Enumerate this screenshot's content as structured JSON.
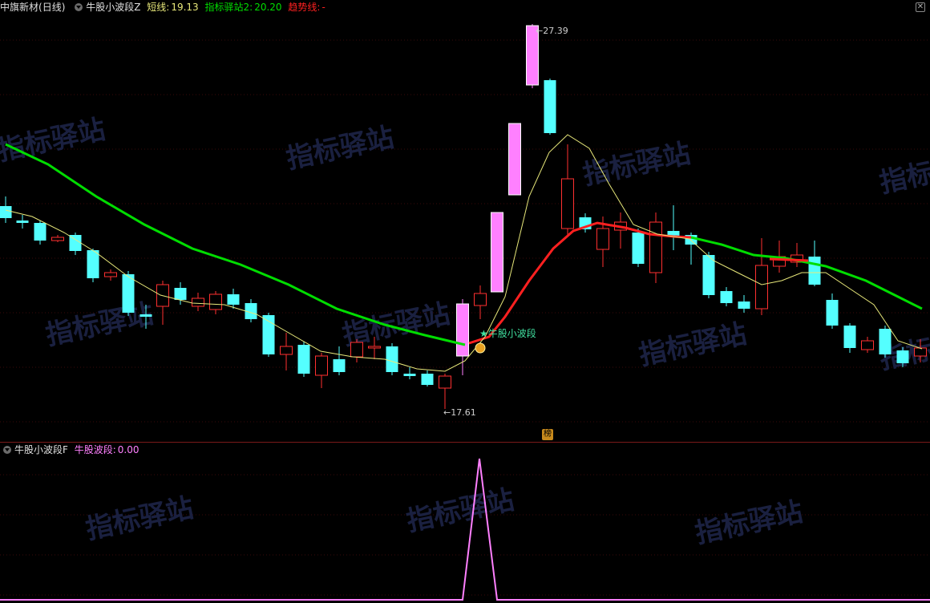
{
  "main": {
    "stock_name": "中旗新材",
    "period": "(日线)",
    "indicator_name": "牛股小波段Z",
    "short_line_label": "短线:",
    "short_line_value": "19.13",
    "zhibiao2_label": "指标驿站2:",
    "zhibiao2_value": "20.20",
    "trend_label": "趋势线:",
    "trend_value": "-",
    "high_label": "27.39",
    "low_label": "17.61",
    "signal_label": "牛股小波段",
    "rank_badge": "榜",
    "colors": {
      "short": "#e8e87a",
      "zhibiao2": "#00dd00",
      "trend": "#ff2020",
      "up": "#ff3030",
      "down": "#54ffff",
      "surge": "#ff80ff"
    }
  },
  "sub": {
    "indicator_name": "牛股小波段F",
    "wave_label": "牛股波段:",
    "wave_value": "0.00",
    "color": "#ff80ff"
  },
  "watermark_text": "指标驿站"
}
